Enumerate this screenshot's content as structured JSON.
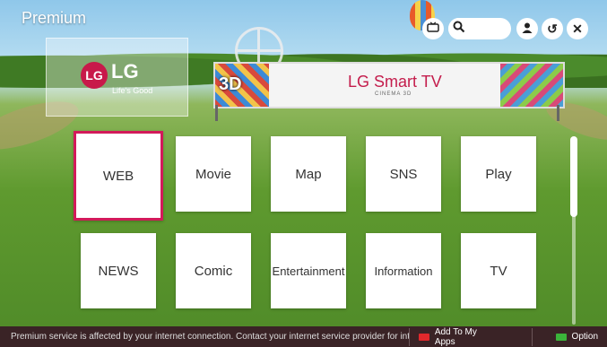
{
  "window": {
    "title": "Premium"
  },
  "brand": {
    "logo_glyph": "LG",
    "lg_text": "LG",
    "tagline": "Life's Good"
  },
  "banner": {
    "badge": "3D",
    "title": "LG Smart TV",
    "subtitle": "CINEMA 3D"
  },
  "toolbar": {
    "icons": [
      "tv-guide-icon",
      "search-icon",
      "user-icon",
      "back-icon",
      "close-icon"
    ],
    "search_placeholder": "",
    "user_glyph": "👤",
    "back_glyph": "↺",
    "close_glyph": "✕"
  },
  "grid": {
    "row1": [
      "WEB",
      "Movie",
      "Map",
      "SNS",
      "Play"
    ],
    "row2": [
      "NEWS",
      "Comic",
      "Entertainment",
      "Information",
      "TV"
    ],
    "selected": "WEB"
  },
  "footer": {
    "status": "Premium service is affected by your internet connection. Contact your internet service provider for inte",
    "add_label": "Add To My Apps",
    "option_label": "Option",
    "key_colors": {
      "red": "#e0282c",
      "green": "#3bb33a"
    }
  },
  "colors": {
    "accent": "#d21a5a"
  }
}
